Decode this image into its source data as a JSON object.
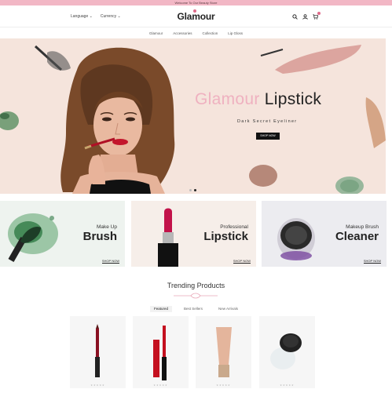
{
  "topbar": {
    "text": "Welcome To Our Beauty Store"
  },
  "header": {
    "language_label": "Language ⌄",
    "currency_label": "Currency ⌄",
    "logo": "Glamour",
    "icons": [
      "search-icon",
      "user-icon",
      "cart-icon"
    ]
  },
  "nav": {
    "items": [
      "Glamour",
      "Accessories",
      "Collection",
      "Lip Gloss"
    ]
  },
  "hero": {
    "title_accent": "Glamour",
    "title_main": "Lipstick",
    "subtitle": "Dark Secret Eyeliner",
    "button": "SHOP NOW",
    "slides": 2,
    "active_slide": 1
  },
  "banners": [
    {
      "small": "Make Up",
      "big": "Brush",
      "shop": "SHOP NOW"
    },
    {
      "small": "Professional",
      "big": "Lipstick",
      "shop": "SHOP NOW"
    },
    {
      "small": "Makeup Brush",
      "big": "Cleaner",
      "shop": "SHOP NOW"
    }
  ],
  "trending": {
    "title": "Trending Products",
    "tabs": [
      "Featured",
      "Best Sellers",
      "New Arrivals"
    ],
    "active_tab": 0,
    "products": [
      {
        "image": "lip-liner-pencil-image",
        "rating": 0
      },
      {
        "image": "lip-gloss-image",
        "rating": 0
      },
      {
        "image": "cream-tube-image",
        "rating": 0
      },
      {
        "image": "loose-powder-image",
        "rating": 0
      }
    ]
  },
  "colors": {
    "accent_pink": "#efb1c0",
    "topbar": "#f2b7c5",
    "hero_bg": "#f5e4dc",
    "button_dark": "#111111"
  }
}
